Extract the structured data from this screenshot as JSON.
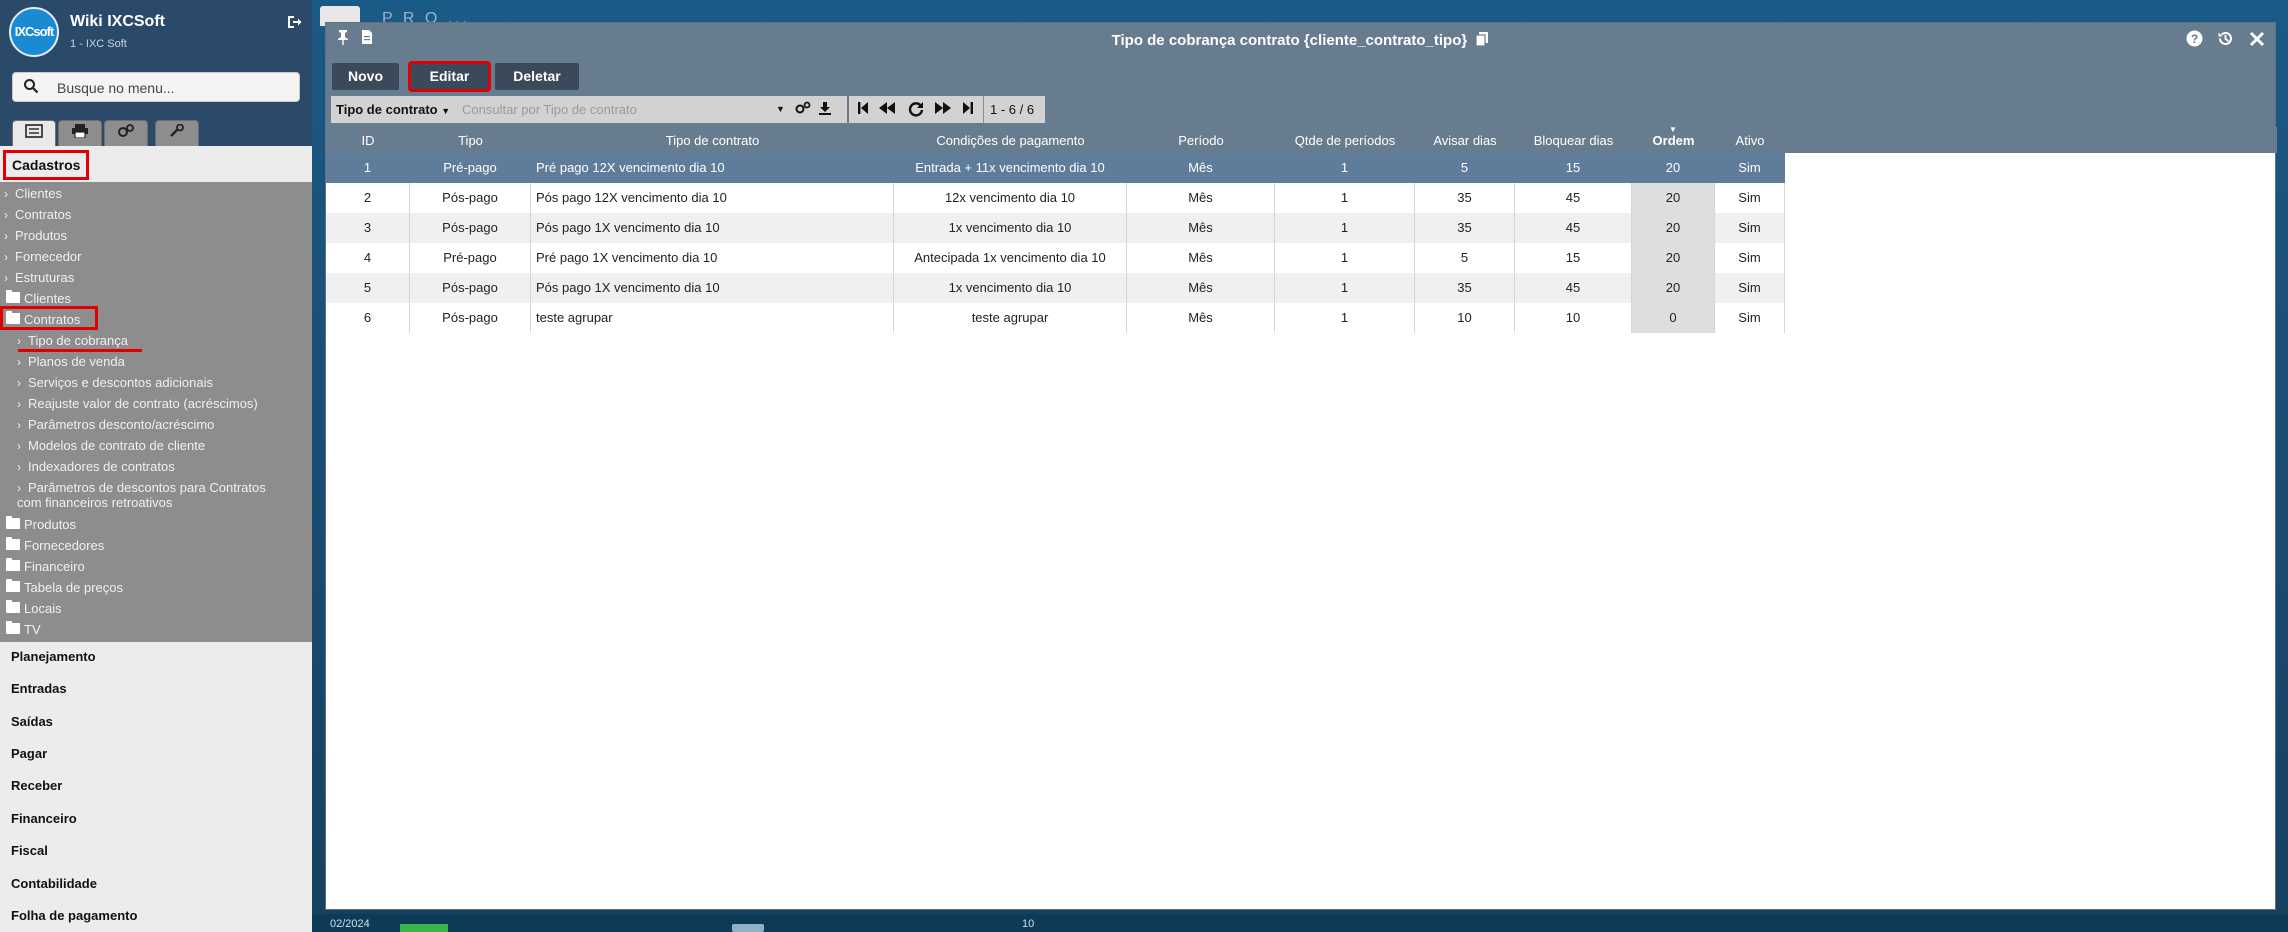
{
  "app": {
    "name": "Wiki IXCSoft",
    "subtitle": "1 - IXC Soft",
    "logo_text": "IXCsoft"
  },
  "sidebar": {
    "search_placeholder": "Busque no menu...",
    "section_title": "Cadastros",
    "collapsed_items": [
      "Clientes",
      "Contratos",
      "Produtos",
      "Fornecedor",
      "Estruturas"
    ],
    "folder_open_clientes": "Clientes",
    "folder_open_contratos": "Contratos",
    "contratos_children": [
      "Tipo de cobrança",
      "Planos de venda",
      "Serviços e descontos adicionais",
      "Reajuste valor de contrato (acréscimos)",
      "Parâmetros desconto/acréscimo",
      "Modelos de contrato de cliente",
      "Indexadores de contratos",
      "Parâmetros de descontos para Contratos",
      "com financeiros retroativos"
    ],
    "folders": [
      "Produtos",
      "Fornecedores",
      "Financeiro",
      "Tabela de preços",
      "Locais",
      "TV"
    ],
    "sections": [
      "Planejamento",
      "Entradas",
      "Saídas",
      "Pagar",
      "Receber",
      "Financeiro",
      "Fiscal",
      "Contabilidade",
      "Folha de pagamento"
    ]
  },
  "window": {
    "title": "Tipo de cobrança contrato {cliente_contrato_tipo}",
    "buttons": {
      "new": "Novo",
      "edit": "Editar",
      "delete": "Deletar"
    },
    "filter": {
      "field_label": "Tipo de contrato",
      "placeholder": "Consultar por Tipo de contrato"
    },
    "pager": {
      "count": "1 - 6 / 6"
    }
  },
  "table": {
    "headers": [
      "ID",
      "Tipo",
      "Tipo de contrato",
      "Condições de pagamento",
      "Período",
      "Qtde de períodos",
      "Avisar dias",
      "Bloquear dias",
      "Ordem",
      "Ativo"
    ],
    "rows": [
      [
        "1",
        "Pré-pago",
        "Pré pago 12X vencimento dia 10",
        "Entrada + 11x vencimento dia 10",
        "Mês",
        "1",
        "5",
        "15",
        "20",
        "Sim"
      ],
      [
        "2",
        "Pós-pago",
        "Pós pago 12X vencimento dia 10",
        "12x vencimento dia 10",
        "Mês",
        "1",
        "35",
        "45",
        "20",
        "Sim"
      ],
      [
        "3",
        "Pós-pago",
        "Pós pago 1X vencimento dia 10",
        "1x vencimento dia 10",
        "Mês",
        "1",
        "35",
        "45",
        "20",
        "Sim"
      ],
      [
        "4",
        "Pré-pago",
        "Pré pago 1X vencimento dia 10",
        "Antecipada 1x vencimento dia 10",
        "Mês",
        "1",
        "5",
        "15",
        "20",
        "Sim"
      ],
      [
        "5",
        "Pós-pago",
        "Pós pago 1X vencimento dia 10",
        "1x vencimento dia 10",
        "Mês",
        "1",
        "35",
        "45",
        "20",
        "Sim"
      ],
      [
        "6",
        "Pós-pago",
        "teste agrupar",
        "teste agrupar",
        "Mês",
        "1",
        "10",
        "10",
        "0",
        "Sim"
      ]
    ]
  },
  "desktop": {
    "tab_label": "P R O ...",
    "bottom_left": "02/2024",
    "bottom_mid": "10"
  },
  "colors": {
    "header_bg": "#687c90",
    "sidebar_head": "#2b4a6a",
    "selected_row": "#5f7d9a",
    "highlight": "#e10000"
  },
  "icons": {
    "search": "search-icon",
    "pin": "pin-icon",
    "file": "file-icon",
    "copy": "copy-icon",
    "help": "help-icon",
    "history": "history-icon",
    "close": "close-icon",
    "logout": "logout-icon"
  }
}
